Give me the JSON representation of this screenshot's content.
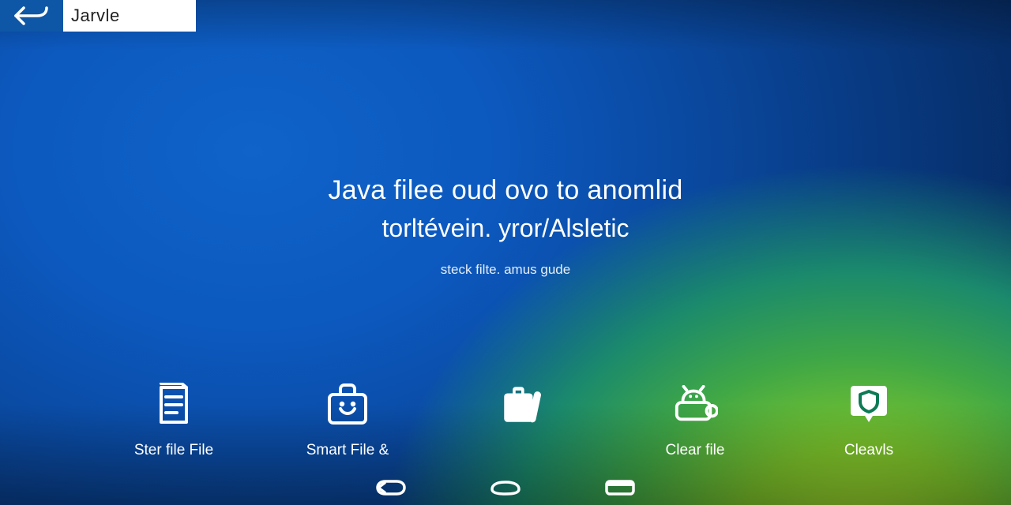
{
  "topbar": {
    "title": "Jarvle"
  },
  "hero": {
    "line1": "Java filee oud ovo to anomlid",
    "line2": "torltévein. yror/Alsletic",
    "sub": "steck filte. amus gude"
  },
  "actions": [
    {
      "id": "ster-file",
      "label": "Ster file File"
    },
    {
      "id": "smart-file",
      "label": "Smart File &"
    },
    {
      "id": "clear-file",
      "label": "Clear file"
    },
    {
      "id": "cleavls",
      "label": "Cleavls"
    }
  ]
}
